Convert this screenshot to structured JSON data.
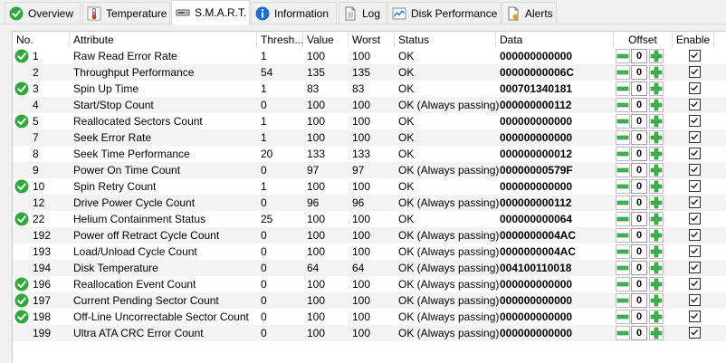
{
  "tabs": [
    {
      "label": "Overview",
      "icon": "green-check-icon",
      "active": false
    },
    {
      "label": "Temperature",
      "icon": "thermometer-icon",
      "active": false
    },
    {
      "label": "S.M.A.R.T.",
      "icon": "drive-icon",
      "active": true
    },
    {
      "label": "Information",
      "icon": "info-icon",
      "active": false
    },
    {
      "label": "Log",
      "icon": "log-icon",
      "active": false
    },
    {
      "label": "Disk Performance",
      "icon": "chart-icon",
      "active": false
    },
    {
      "label": "Alerts",
      "icon": "alerts-icon",
      "active": false
    }
  ],
  "columns": {
    "no": "No.",
    "attribute": "Attribute",
    "threshold": "Thresh...",
    "value": "Value",
    "worst": "Worst",
    "status": "Status",
    "data": "Data",
    "offset": "Offset",
    "enable": "Enable"
  },
  "rows": [
    {
      "no": "1",
      "attribute": "Raw Read Error Rate",
      "threshold": "1",
      "value": "100",
      "worst": "100",
      "status": "OK",
      "data": "000000000000",
      "offset": "0",
      "enabled": true,
      "ok_icon": true
    },
    {
      "no": "2",
      "attribute": "Throughput Performance",
      "threshold": "54",
      "value": "135",
      "worst": "135",
      "status": "OK",
      "data": "00000000006C",
      "offset": "0",
      "enabled": true,
      "ok_icon": false
    },
    {
      "no": "3",
      "attribute": "Spin Up Time",
      "threshold": "1",
      "value": "83",
      "worst": "83",
      "status": "OK",
      "data": "000701340181",
      "offset": "0",
      "enabled": true,
      "ok_icon": true
    },
    {
      "no": "4",
      "attribute": "Start/Stop Count",
      "threshold": "0",
      "value": "100",
      "worst": "100",
      "status": "OK (Always passing)",
      "data": "000000000112",
      "offset": "0",
      "enabled": true,
      "ok_icon": false
    },
    {
      "no": "5",
      "attribute": "Reallocated Sectors Count",
      "threshold": "1",
      "value": "100",
      "worst": "100",
      "status": "OK",
      "data": "000000000000",
      "offset": "0",
      "enabled": true,
      "ok_icon": true
    },
    {
      "no": "7",
      "attribute": "Seek Error Rate",
      "threshold": "1",
      "value": "100",
      "worst": "100",
      "status": "OK",
      "data": "000000000000",
      "offset": "0",
      "enabled": true,
      "ok_icon": false
    },
    {
      "no": "8",
      "attribute": "Seek Time Performance",
      "threshold": "20",
      "value": "133",
      "worst": "133",
      "status": "OK",
      "data": "000000000012",
      "offset": "0",
      "enabled": true,
      "ok_icon": false
    },
    {
      "no": "9",
      "attribute": "Power On Time Count",
      "threshold": "0",
      "value": "97",
      "worst": "97",
      "status": "OK (Always passing)",
      "data": "00000000579F",
      "offset": "0",
      "enabled": true,
      "ok_icon": false
    },
    {
      "no": "10",
      "attribute": "Spin Retry Count",
      "threshold": "1",
      "value": "100",
      "worst": "100",
      "status": "OK",
      "data": "000000000000",
      "offset": "0",
      "enabled": true,
      "ok_icon": true
    },
    {
      "no": "12",
      "attribute": "Drive Power Cycle Count",
      "threshold": "0",
      "value": "96",
      "worst": "96",
      "status": "OK (Always passing)",
      "data": "000000000112",
      "offset": "0",
      "enabled": true,
      "ok_icon": false
    },
    {
      "no": "22",
      "attribute": "Helium Containment Status",
      "threshold": "25",
      "value": "100",
      "worst": "100",
      "status": "OK",
      "data": "000000000064",
      "offset": "0",
      "enabled": true,
      "ok_icon": true
    },
    {
      "no": "192",
      "attribute": "Power off Retract Cycle Count",
      "threshold": "0",
      "value": "100",
      "worst": "100",
      "status": "OK (Always passing)",
      "data": "0000000004AC",
      "offset": "0",
      "enabled": true,
      "ok_icon": false
    },
    {
      "no": "193",
      "attribute": "Load/Unload Cycle Count",
      "threshold": "0",
      "value": "100",
      "worst": "100",
      "status": "OK (Always passing)",
      "data": "0000000004AC",
      "offset": "0",
      "enabled": true,
      "ok_icon": false
    },
    {
      "no": "194",
      "attribute": "Disk Temperature",
      "threshold": "0",
      "value": "64",
      "worst": "64",
      "status": "OK (Always passing)",
      "data": "004100110018",
      "offset": "0",
      "enabled": true,
      "ok_icon": false
    },
    {
      "no": "196",
      "attribute": "Reallocation Event Count",
      "threshold": "0",
      "value": "100",
      "worst": "100",
      "status": "OK (Always passing)",
      "data": "000000000000",
      "offset": "0",
      "enabled": true,
      "ok_icon": true
    },
    {
      "no": "197",
      "attribute": "Current Pending Sector Count",
      "threshold": "0",
      "value": "100",
      "worst": "100",
      "status": "OK (Always passing)",
      "data": "000000000000",
      "offset": "0",
      "enabled": true,
      "ok_icon": true
    },
    {
      "no": "198",
      "attribute": "Off-Line Uncorrectable Sector Count",
      "threshold": "0",
      "value": "100",
      "worst": "100",
      "status": "OK (Always passing)",
      "data": "000000000000",
      "offset": "0",
      "enabled": true,
      "ok_icon": true
    },
    {
      "no": "199",
      "attribute": "Ultra ATA CRC Error Count",
      "threshold": "0",
      "value": "100",
      "worst": "100",
      "status": "OK (Always passing)",
      "data": "000000000000",
      "offset": "0",
      "enabled": true,
      "ok_icon": false
    }
  ],
  "colors": {
    "ok_green": "#2eaa3c",
    "stepper_green": "#3db54a",
    "alt_row": "#f3f3f3"
  }
}
